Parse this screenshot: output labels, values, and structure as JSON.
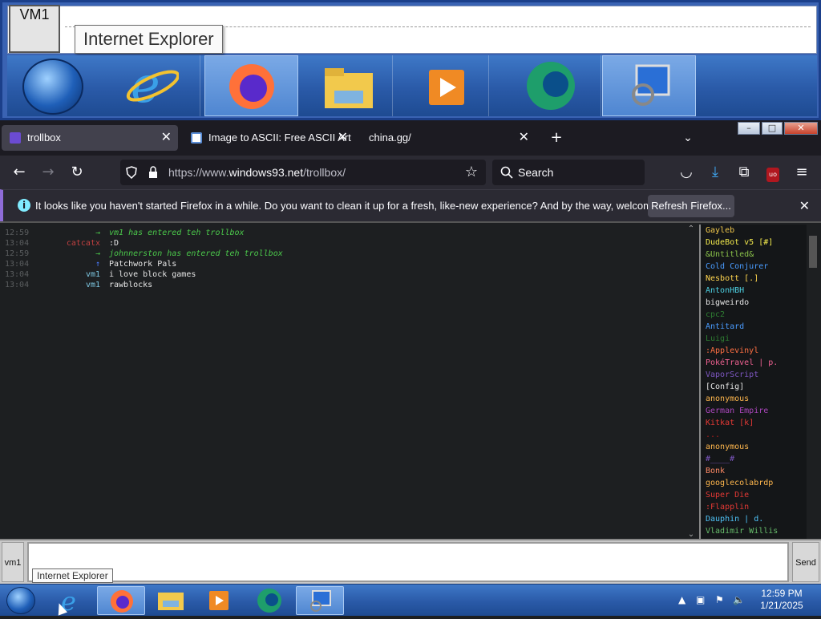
{
  "zoom": {
    "thumb_label": "VM1",
    "tooltip": "Internet Explorer"
  },
  "tabs": [
    {
      "title": "trollbox",
      "active": true
    },
    {
      "title": "Image to ASCII: Free ASCII Art C",
      "active": false
    },
    {
      "title": "china.gg/",
      "active": false
    }
  ],
  "nav": {
    "url_prefix": "https://www.",
    "url_host": "windows93.net",
    "url_path": "/trollbox/",
    "search_placeholder": "Search"
  },
  "notice": {
    "text": "It looks like you haven't started Firefox in a while. Do you want to clean it up for a fresh, like-new experience? And by the way, welcome back!",
    "button": "Refresh Firefox..."
  },
  "chat": [
    {
      "time": "12:59",
      "nick": "→",
      "nick_color": "#4bc94b",
      "body": "vm1 has entered teh trollbox",
      "body_color": "#4bc94b",
      "italic": true
    },
    {
      "time": "13:04",
      "nick": "catcatx",
      "nick_color": "#c04040",
      "body": ":D",
      "body_color": "#e5e5e5",
      "italic": false
    },
    {
      "time": "12:59",
      "nick": "→",
      "nick_color": "#4bc94b",
      "body": "johnnerston has entered teh trollbox",
      "body_color": "#4bc94b",
      "italic": true
    },
    {
      "time": "13:04",
      "nick": "↑",
      "nick_color": "#4a7cff",
      "body": "Patchwork Pals",
      "body_color": "#e5e5e5",
      "italic": false
    },
    {
      "time": "13:04",
      "nick": "vm1",
      "nick_color": "#7ec8e3",
      "body": "i love block games",
      "body_color": "#e5e5e5",
      "italic": false
    },
    {
      "time": "13:04",
      "nick": "vm1",
      "nick_color": "#7ec8e3",
      "body": "rawblocks",
      "body_color": "#e5e5e5",
      "italic": false
    }
  ],
  "users": [
    {
      "name": "Gayleb",
      "color": "#f2c94c"
    },
    {
      "name": "DudeBot v5 [#]",
      "color": "#f2e94c"
    },
    {
      "name": "&Untitled&",
      "color": "#8bc34a"
    },
    {
      "name": "Cold Conjurer",
      "color": "#4a9cff"
    },
    {
      "name": "Nesbott [.]",
      "color": "#ffd54f"
    },
    {
      "name": "AntonHBH",
      "color": "#4dd0e1"
    },
    {
      "name": "bigweirdo",
      "color": "#e5e5e5"
    },
    {
      "name": "cpc2",
      "color": "#2e7d32"
    },
    {
      "name": "Antitard",
      "color": "#4a9cff"
    },
    {
      "name": "Luigi",
      "color": "#2e7d32"
    },
    {
      "name": ":Applevinyl",
      "color": "#ff7043"
    },
    {
      "name": "PokéTravel | p.",
      "color": "#f06292"
    },
    {
      "name": "VaporScript",
      "color": "#7e57c2"
    },
    {
      "name": "[Config]",
      "color": "#e5e5e5"
    },
    {
      "name": "anonymous",
      "color": "#ffb74d"
    },
    {
      "name": "German Empire",
      "color": "#ab47bc"
    },
    {
      "name": "Kitkat [k]",
      "color": "#e53935"
    },
    {
      "name": "...",
      "color": "#b71c1c"
    },
    {
      "name": "anonymous",
      "color": "#ffb74d"
    },
    {
      "name": "#____#",
      "color": "#7e57c2"
    },
    {
      "name": "Bonk",
      "color": "#ff8a65"
    },
    {
      "name": "googlecolabrdp",
      "color": "#ffb74d"
    },
    {
      "name": "Super Die",
      "color": "#e53935"
    },
    {
      "name": ":Flapplin",
      "color": "#e53935"
    },
    {
      "name": "Dauphin | d.",
      "color": "#4fc3f7"
    },
    {
      "name": "Vladimir Willis",
      "color": "#66bb6a"
    }
  ],
  "input": {
    "nick": "vm1",
    "send": "Send",
    "tooltip": "Internet Explorer"
  },
  "taskbar": {
    "time": "12:59 PM",
    "date": "1/21/2025"
  }
}
